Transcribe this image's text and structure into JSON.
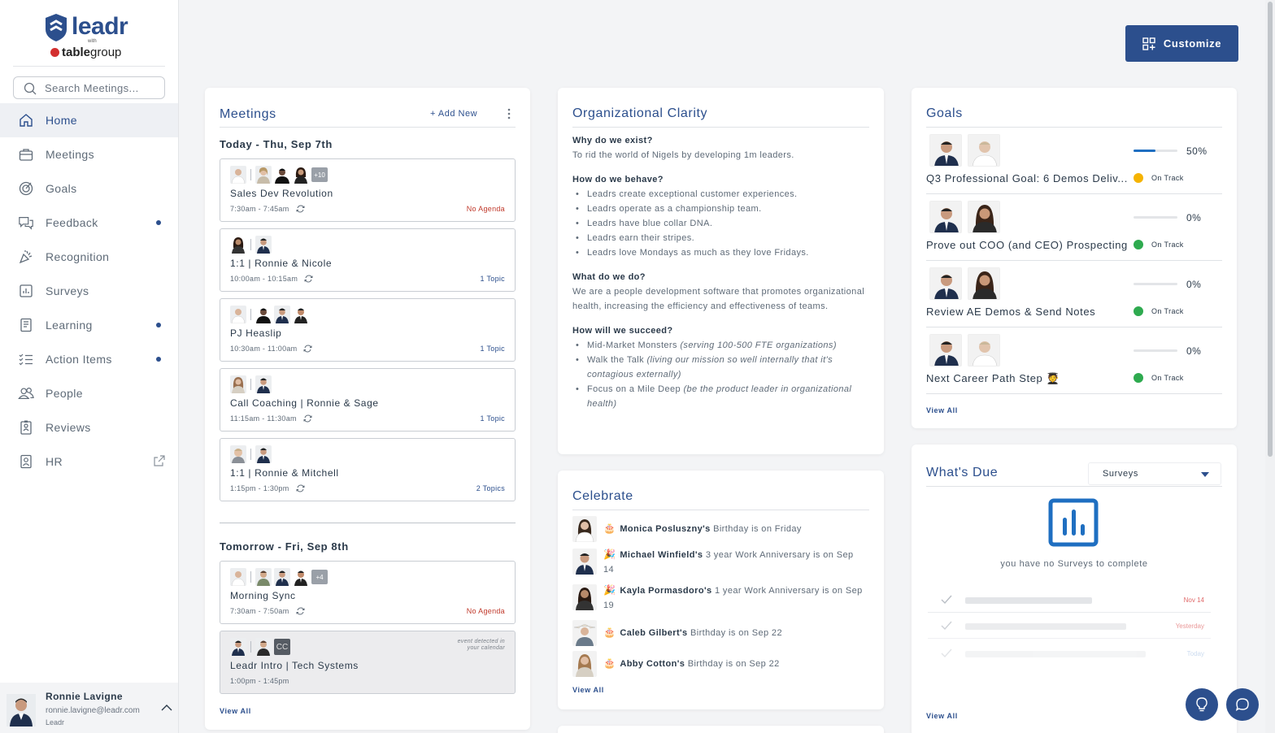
{
  "brand": {
    "name": "leadr",
    "with": "with",
    "partner_bold": "table",
    "partner_rest": "group"
  },
  "search": {
    "placeholder": "Search Meetings..."
  },
  "nav": [
    {
      "label": "Home",
      "icon": "home-icon",
      "active": true
    },
    {
      "label": "Meetings",
      "icon": "briefcase-icon"
    },
    {
      "label": "Goals",
      "icon": "target-icon"
    },
    {
      "label": "Feedback",
      "icon": "chat-bubbles-icon",
      "dot": true
    },
    {
      "label": "Recognition",
      "icon": "party-popper-icon"
    },
    {
      "label": "Surveys",
      "icon": "survey-chart-icon"
    },
    {
      "label": "Learning",
      "icon": "book-icon",
      "dot": true
    },
    {
      "label": "Action Items",
      "icon": "checklist-icon",
      "dot": true
    },
    {
      "label": "People",
      "icon": "people-icon"
    },
    {
      "label": "Reviews",
      "icon": "review-clipboard-icon"
    },
    {
      "label": "HR",
      "icon": "hr-badge-icon",
      "external": true
    }
  ],
  "user": {
    "name": "Ronnie Lavigne",
    "email": "ronnie.lavigne@leadr.com",
    "org": "Leadr"
  },
  "customize_label": "Customize",
  "meetings": {
    "title": "Meetings",
    "add_new": "+ Add New",
    "today_label": "Today - Thu, Sep 7th",
    "tomorrow_label": "Tomorrow - Fri, Sep 8th",
    "view_all": "View All",
    "today": [
      {
        "title": "Sales Dev Revolution",
        "time": "7:30am - 7:45am",
        "right": "No Agenda",
        "more": "+10"
      },
      {
        "title": "1:1 | Ronnie & Nicole",
        "time": "10:00am - 10:15am",
        "right": "1 Topic"
      },
      {
        "title": "PJ Heaslip",
        "time": "10:30am - 11:00am",
        "right": "1 Topic"
      },
      {
        "title": "Call Coaching | Ronnie & Sage",
        "time": "11:15am - 11:30am",
        "right": "1 Topic"
      },
      {
        "title": "1:1 | Ronnie & Mitchell",
        "time": "1:15pm - 1:30pm",
        "right": "2 Topics"
      }
    ],
    "tomorrow": [
      {
        "title": "Morning Sync",
        "time": "7:30am - 7:50am",
        "right": "No Agenda",
        "more": "+4"
      },
      {
        "title": "Leadr Intro | Tech Systems",
        "time": "1:00pm - 1:45pm",
        "detected_line1": "event detected in",
        "detected_line2": "your calendar",
        "initials": "CC"
      }
    ]
  },
  "org_clarity": {
    "title": "Organizational Clarity",
    "q1": "Why do we exist?",
    "a1": "To rid the world of Nigels by developing 1m leaders.",
    "q2": "How do we behave?",
    "behave": [
      "Leadrs create exceptional customer experiences.",
      "Leadrs operate as a championship team.",
      "Leadrs have blue collar DNA.",
      "Leadrs earn their stripes.",
      "Leadrs love Mondays as much as they love Fridays."
    ],
    "q3": "What do we do?",
    "a3": "We are a people development software that promotes organizational health, increasing the efficiency and effectiveness of teams.",
    "q4": "How will we succeed?",
    "succeed": [
      {
        "text": "Mid-Market Monsters ",
        "italic": "(serving 100-500 FTE organizations)"
      },
      {
        "text": "Walk the Talk ",
        "italic": "(living our mission so well internally that it's contagious externally)"
      },
      {
        "text": "Focus on a Mile Deep ",
        "italic": "(be the product leader in organizational health)"
      }
    ]
  },
  "celebrate": {
    "title": "Celebrate",
    "view_all": "View All",
    "items": [
      {
        "emoji": "🎂",
        "name": "Monica Posluszny's",
        "text": " Birthday is on Friday"
      },
      {
        "emoji": "🎉",
        "name": "Michael Winfield's",
        "text": " 3 year Work Anniversary is on Sep 14"
      },
      {
        "emoji": "🎉",
        "name": "Kayla Pormasdoro's",
        "text": " 1 year Work Anniversary is on Sep 19"
      },
      {
        "emoji": "🎂",
        "name": "Caleb Gilbert's",
        "text": " Birthday is on Sep 22"
      },
      {
        "emoji": "🎂",
        "name": "Abby Cotton's",
        "text": " Birthday is on Sep 22"
      }
    ]
  },
  "goals": {
    "title": "Goals",
    "view_all": "View All",
    "items": [
      {
        "title": "Q3 Professional Goal: 6 Demos Deliv...",
        "percent": "50%",
        "progress": 0.5,
        "status": "On Track",
        "status_color": "#f5b301"
      },
      {
        "title": "Prove out COO (and CEO) Prospecting",
        "percent": "0%",
        "progress": 0,
        "status": "On Track",
        "status_color": "#2eaa4f"
      },
      {
        "title": "Review AE Demos & Send Notes",
        "percent": "0%",
        "progress": 0,
        "status": "On Track",
        "status_color": "#2eaa4f"
      },
      {
        "title": "Next Career Path Step 🧑‍🎓",
        "percent": "0%",
        "progress": 0,
        "status": "On Track",
        "status_color": "#2eaa4f"
      }
    ]
  },
  "whats_due": {
    "title": "What's Due",
    "filter_value": "Surveys",
    "empty_message": "you have no Surveys to complete",
    "ghost_dates": [
      "Nov 14",
      "Yesterday",
      "Today"
    ],
    "view_all": "View All"
  },
  "colors": {
    "brand": "#2c4f8d",
    "on_track": "#2eaa4f",
    "at_risk": "#f5b301"
  }
}
